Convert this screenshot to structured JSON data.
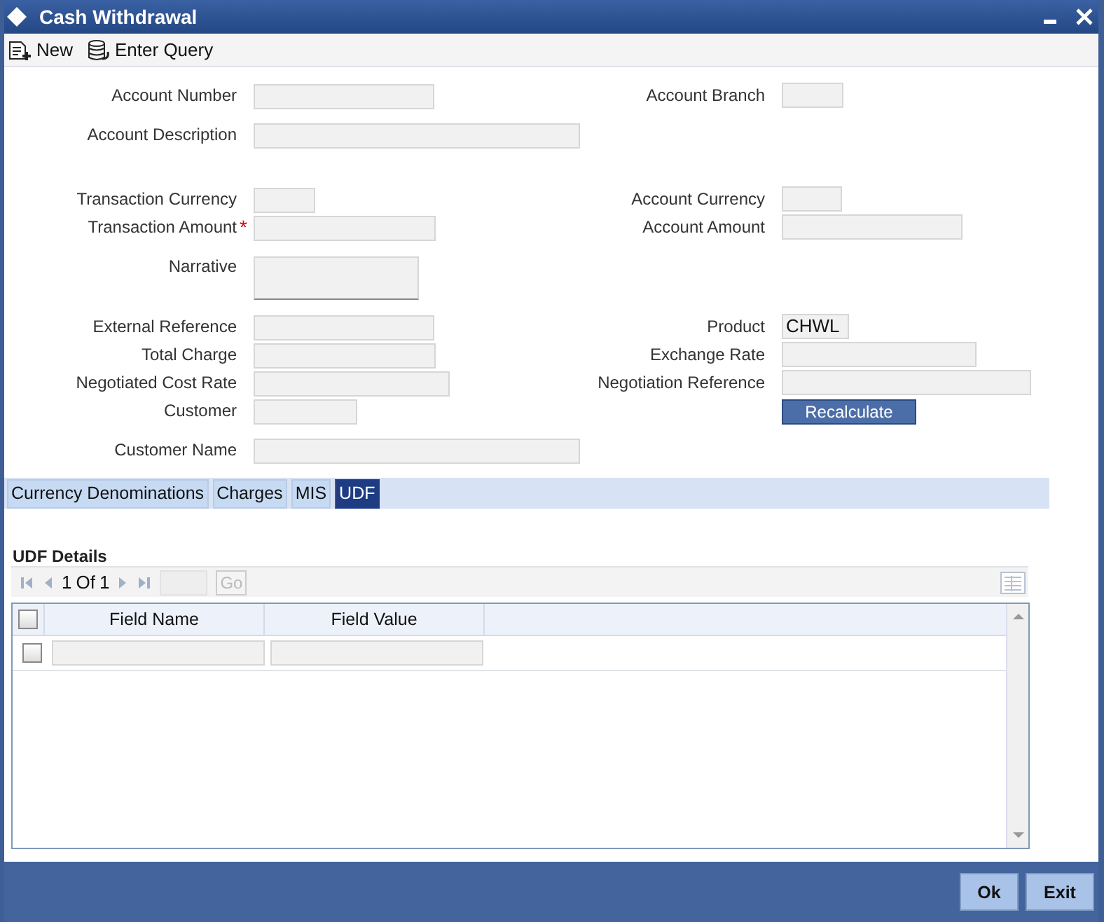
{
  "window": {
    "title": "Cash Withdrawal"
  },
  "toolbar": [
    {
      "kind": "new",
      "label": "New"
    },
    {
      "kind": "query",
      "label": "Enter Query"
    }
  ],
  "form": {
    "rows": [
      {
        "left": {
          "label": "Account Number",
          "kind": "text"
        },
        "right": {
          "label": "Account Branch",
          "kind": "text"
        }
      },
      {
        "left": {
          "label": "Account Description",
          "kind": "text"
        }
      },
      {
        "left": {
          "label": "Transaction Currency",
          "kind": "text"
        },
        "right": {
          "label": "Account Currency",
          "kind": "text"
        }
      },
      {
        "left": {
          "label": "Transaction Amount",
          "required_mark": "*",
          "kind": "text"
        },
        "right": {
          "label": "Account Amount",
          "kind": "text"
        }
      },
      {
        "left": {
          "label": "Narrative",
          "kind": "textarea"
        }
      },
      {
        "left": {
          "label": "External Reference",
          "kind": "text"
        },
        "right": {
          "label": "Product",
          "kind": "text",
          "value": "CHWL"
        }
      },
      {
        "left": {
          "label": "Total Charge",
          "kind": "text"
        },
        "right": {
          "label": "Exchange Rate",
          "kind": "text"
        }
      },
      {
        "left": {
          "label": "Negotiated Cost Rate",
          "kind": "text"
        },
        "right": {
          "label": "Negotiation Reference",
          "kind": "text"
        }
      },
      {
        "left": {
          "label": "Customer",
          "kind": "text"
        },
        "right": {
          "kind": "button",
          "label": "Recalculate"
        }
      },
      {
        "left": {
          "label": "Customer Name",
          "kind": "text"
        }
      }
    ]
  },
  "tabs": [
    {
      "label": "Currency Denominations",
      "selected": false
    },
    {
      "label": "Charges",
      "selected": false
    },
    {
      "label": "MIS",
      "selected": false
    },
    {
      "label": "UDF",
      "selected": true
    }
  ],
  "udf": {
    "title": "UDF Details",
    "pager": {
      "page": "1",
      "of": "Of",
      "total": "1",
      "go": {
        "label": "Go",
        "disabled": true
      }
    },
    "columns": [
      "Field Name",
      "Field Value"
    ],
    "header_checked": false,
    "rows": [
      {
        "checked": false
      }
    ]
  },
  "buttons": [
    "Ok",
    "Exit"
  ]
}
